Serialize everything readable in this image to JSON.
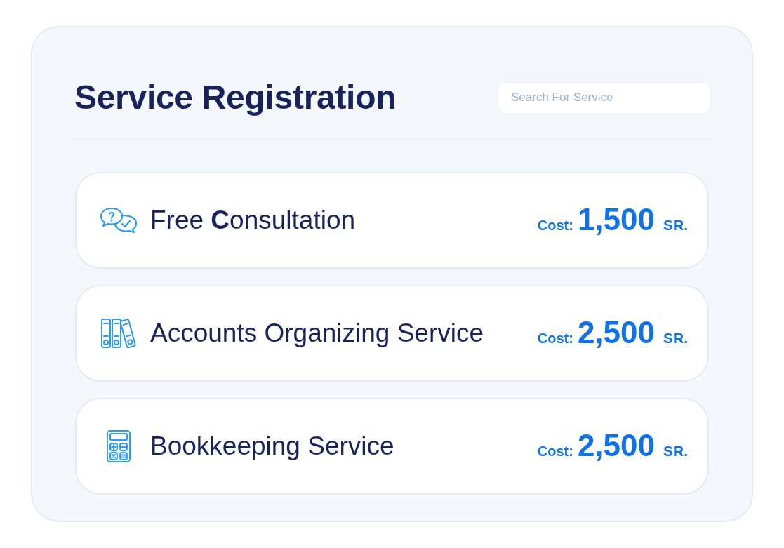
{
  "title": "Service Registration",
  "search": {
    "placeholder": "Search For Service"
  },
  "services": [
    {
      "kind": "consultation",
      "name": "Free **C**onsultation",
      "cost_label": "Cost:",
      "amount": "1,500",
      "currency": "SR."
    },
    {
      "kind": "binders",
      "name": "Accounts Organizing Service",
      "cost_label": "Cost:",
      "amount": "2,500",
      "currency": "SR."
    },
    {
      "kind": "calculator",
      "name": "Bookkeeping Service",
      "cost_label": "Cost:",
      "amount": "2,500",
      "currency": "SR."
    }
  ]
}
